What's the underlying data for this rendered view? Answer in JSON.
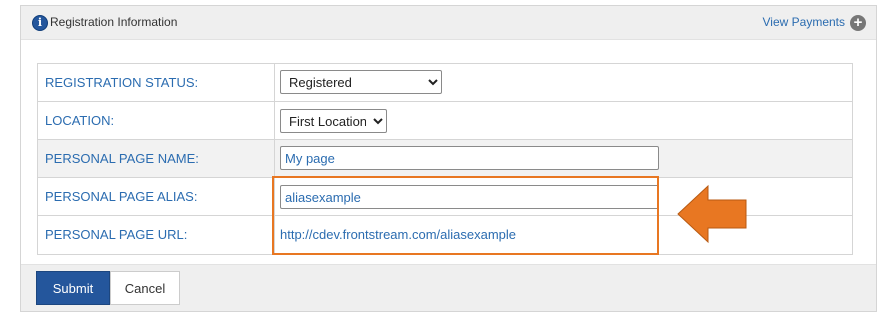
{
  "header": {
    "title": "Registration Information",
    "view_payments": "View Payments",
    "info_icon_glyph": "i",
    "plus_icon_glyph": "+"
  },
  "form": {
    "registration_status": {
      "label": "REGISTRATION STATUS:",
      "value": "Registered"
    },
    "location": {
      "label": "LOCATION:",
      "value": "First Location"
    },
    "personal_page_name": {
      "label": "PERSONAL PAGE NAME:",
      "value": "My page"
    },
    "personal_page_alias": {
      "label": "PERSONAL PAGE ALIAS:",
      "value": "aliasexample"
    },
    "personal_page_url": {
      "label": "PERSONAL PAGE URL:",
      "value": "http://cdev.frontstream.com/aliasexample"
    }
  },
  "footer": {
    "submit_label": "Submit",
    "cancel_label": "Cancel"
  },
  "colors": {
    "label_blue": "#2b6cb0",
    "primary_button": "#24569c",
    "highlight_orange": "#e87722"
  },
  "icons": {
    "info": "info-icon",
    "add": "plus-circle-icon",
    "annotation_arrow": "left-arrow-icon",
    "select_dropdown": "chevron-down-icon"
  }
}
